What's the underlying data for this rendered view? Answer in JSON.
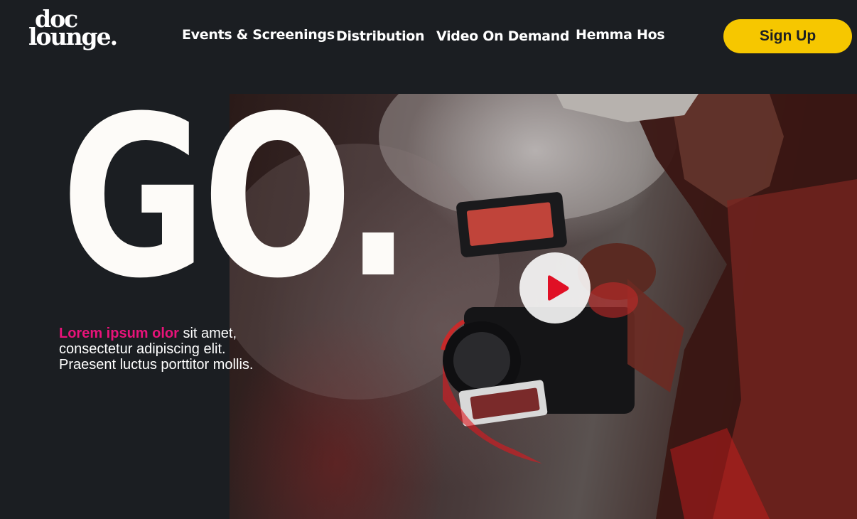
{
  "logo": {
    "line1": "doc",
    "line2": "lounge."
  },
  "nav": {
    "items": [
      {
        "label": "Events & Screenings"
      },
      {
        "label": "Distribution"
      },
      {
        "label": "Video On Demand"
      },
      {
        "label": "Hemma Hos"
      }
    ]
  },
  "signup": {
    "label": "Sign Up"
  },
  "hero": {
    "headline": "GO.",
    "intro_highlight": "Lorem ipsum olor",
    "intro_rest": " sit amet, consectetur adipiscing elit. Praesent luctus porttitor mollis."
  },
  "colors": {
    "background": "#1b1e22",
    "accent_yellow": "#f6c700",
    "accent_pink": "#e8137a",
    "play_red": "#e01025"
  },
  "icons": {
    "play": "play-icon"
  }
}
